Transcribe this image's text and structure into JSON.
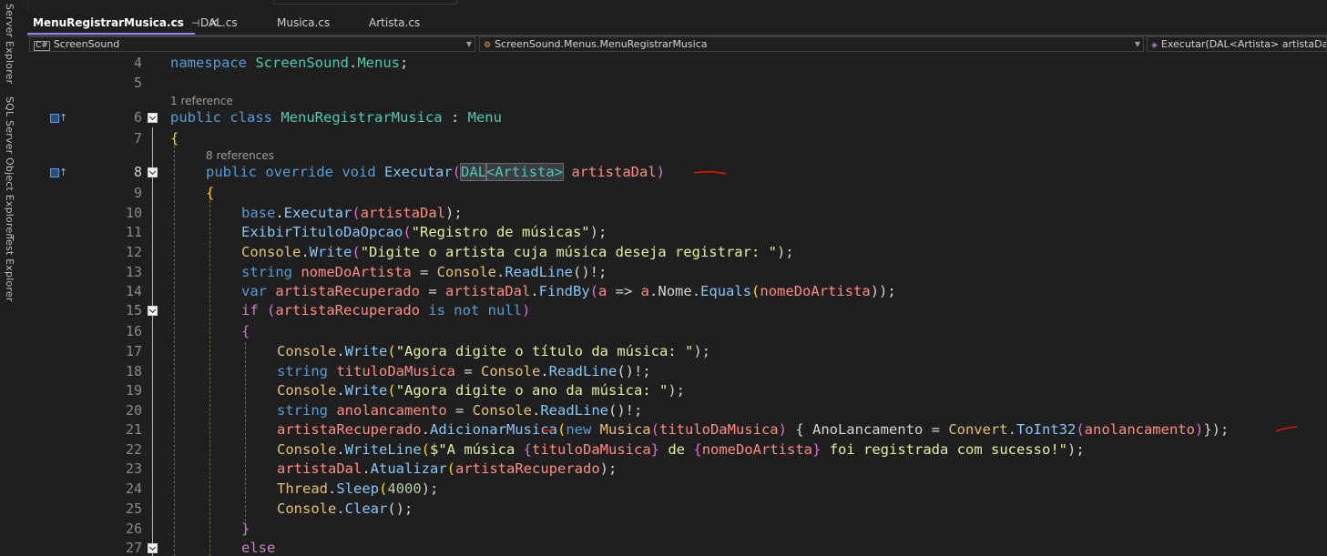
{
  "side_tabs": [
    "Server Explorer",
    "SQL Server Object Explorer",
    "Test Explorer"
  ],
  "tabs": [
    {
      "label": "MenuRegistrarMusica.cs",
      "active": true
    },
    {
      "label": "DAL.cs",
      "active": false
    },
    {
      "label": "Musica.cs",
      "active": false
    },
    {
      "label": "Artista.cs",
      "active": false
    }
  ],
  "tab_controls": {
    "pin": "⊣",
    "close": "×"
  },
  "nav": {
    "project_icon": "C#",
    "project": "ScreenSound",
    "class_path": "ScreenSound.Menus.MenuRegistrarMusica",
    "member": "Executar(DAL<Artista> artistaDal)"
  },
  "code_lens": {
    "class_refs": "1 reference",
    "method_refs": "8 references"
  },
  "line_numbers": [
    "4",
    "5",
    "6",
    "7",
    "8",
    "9",
    "10",
    "11",
    "12",
    "13",
    "14",
    "15",
    "16",
    "17",
    "18",
    "19",
    "20",
    "21",
    "22",
    "23",
    "24",
    "25",
    "26",
    "27"
  ],
  "code_lines": {
    "l4_a": "namespace",
    "l4_b": " ScreenSound",
    "l4_c": ".",
    "l4_d": "Menus",
    "l4_e": ";",
    "l6_a": "public",
    "l6_b": " class",
    "l6_c": " MenuRegistrarMusica",
    "l6_d": " : ",
    "l6_e": "Menu",
    "l7": "{",
    "l8_a": "public",
    "l8_b": " override",
    "l8_c": " void",
    "l8_d": " Executar",
    "l8_e": "(",
    "l8_f": "DAL",
    "l8_g": "<Artista>",
    "l8_h": " artistaDal",
    "l8_i": ")",
    "l9": "{",
    "l10_a": "base",
    "l10_b": ".",
    "l10_c": "Executar",
    "l10_d": "(",
    "l10_e": "artistaDal",
    "l10_f": ");",
    "l11_a": "ExibirTituloDaOpcao",
    "l11_b": "(",
    "l11_c": "\"Registro de músicas\"",
    "l11_d": ");",
    "l12_a": "Console",
    "l12_b": ".",
    "l12_c": "Write",
    "l12_d": "(",
    "l12_e": "\"Digite o artista cuja música deseja registrar: \"",
    "l12_f": ");",
    "l13_a": "string",
    "l13_b": " nomeDoArtista",
    "l13_c": " = ",
    "l13_d": "Console",
    "l13_e": ".",
    "l13_f": "ReadLine",
    "l13_g": "()!;",
    "l14_a": "var",
    "l14_b": " artistaRecuperado",
    "l14_c": " = ",
    "l14_d": "artistaDal",
    "l14_e": ".",
    "l14_f": "FindBy",
    "l14_g": "(",
    "l14_h": "a",
    "l14_i": " => ",
    "l14_j": "a",
    "l14_k": ".",
    "l14_l": "Nome",
    "l14_m": ".",
    "l14_n": "Equals",
    "l14_o": "(",
    "l14_p": "nomeDoArtista",
    "l14_q": "));",
    "l15_a": "if",
    "l15_b": " (",
    "l15_c": "artistaRecuperado",
    "l15_d": " is not null",
    "l15_e": ")",
    "l16": "{",
    "l17_a": "Console",
    "l17_b": ".",
    "l17_c": "Write",
    "l17_d": "(",
    "l17_e": "\"Agora digite o título da música: \"",
    "l17_f": ");",
    "l18_a": "string",
    "l18_b": " tituloDaMusica",
    "l18_c": " = ",
    "l18_d": "Console",
    "l18_e": ".",
    "l18_f": "ReadLine",
    "l18_g": "()!;",
    "l19_a": "Console",
    "l19_b": ".",
    "l19_c": "Write",
    "l19_d": "(",
    "l19_e": "\"Agora digite o ano da música: \"",
    "l19_f": ");",
    "l20_a": "string",
    "l20_b": " anolancamento",
    "l20_c": " = ",
    "l20_d": "Console",
    "l20_e": ".",
    "l20_f": "ReadLine",
    "l20_g": "()!;",
    "l21_a": "artistaRecuperado",
    "l21_b": ".",
    "l21_c": "AdicionarMusica",
    "l21_d": "(",
    "l21_e": "new",
    "l21_f": " Musica",
    "l21_g": "(",
    "l21_h": "tituloDaMusica",
    "l21_i": ")",
    "l21_j": " { ",
    "l21_k": "AnoLancamento",
    "l21_l": " = ",
    "l21_m": "Convert",
    "l21_n": ".",
    "l21_o": "ToInt32",
    "l21_p": "(",
    "l21_q": "anolancamento",
    "l21_r": ")",
    "l21_s": "});",
    "l22_a": "Console",
    "l22_b": ".",
    "l22_c": "WriteLine",
    "l22_d": "(",
    "l22_e": "$\"A música ",
    "l22_f": "{",
    "l22_g": "tituloDaMusica",
    "l22_h": "}",
    "l22_i": " de ",
    "l22_j": "{",
    "l22_k": "nomeDoArtista",
    "l22_l": "}",
    "l22_m": " foi registrada com sucesso!\"",
    "l22_n": ");",
    "l23_a": "artistaDal",
    "l23_b": ".",
    "l23_c": "Atualizar",
    "l23_d": "(",
    "l23_e": "artistaRecuperado",
    "l23_f": ");",
    "l24_a": "Thread",
    "l24_b": ".",
    "l24_c": "Sleep",
    "l24_d": "(",
    "l24_e": "4000",
    "l24_f": ");",
    "l25_a": "Console",
    "l25_b": ".",
    "l25_c": "Clear",
    "l25_d": "();",
    "l26": "}",
    "l27": "else"
  },
  "colors": {
    "background": "#1f1f1f",
    "keyword": "#569cd6",
    "control_keyword": "#c586c0",
    "type": "#4ec9b0",
    "method": "#86c7f7",
    "variable": "#ff8c82",
    "string": "#e2ef9f",
    "number": "#b5cea8",
    "annotation_red": "#e51400",
    "active_tab_accent": "#9184ee"
  }
}
